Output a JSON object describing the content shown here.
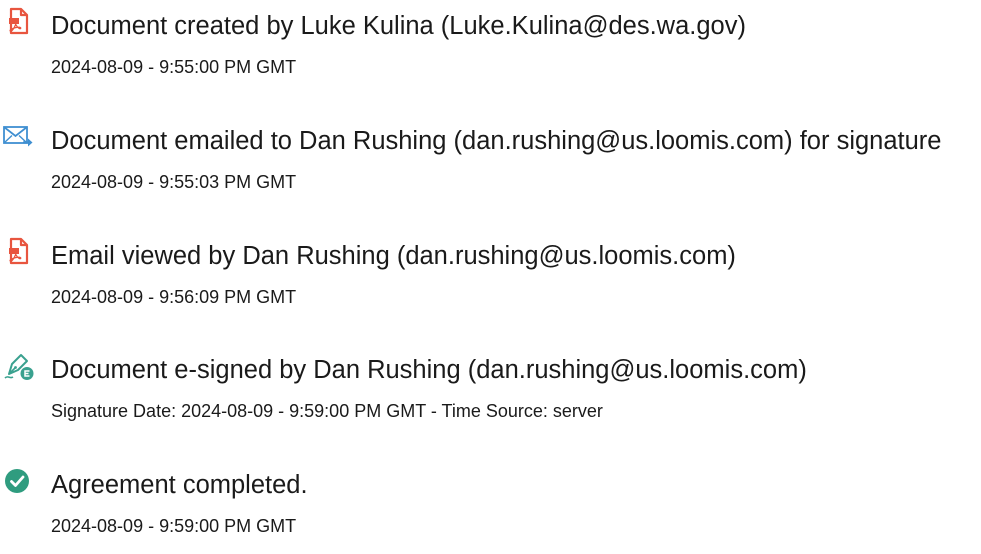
{
  "events": [
    {
      "icon": "document-created-icon",
      "title": "Document created by Luke Kulina (Luke.Kulina@des.wa.gov)",
      "detail": "2024-08-09 - 9:55:00 PM GMT"
    },
    {
      "icon": "email-sent-icon",
      "title": "Document emailed to Dan Rushing (dan.rushing@us.loomis.com) for signature",
      "detail": "2024-08-09 - 9:55:03 PM GMT"
    },
    {
      "icon": "email-viewed-icon",
      "title": "Email viewed by Dan Rushing (dan.rushing@us.loomis.com)",
      "detail": "2024-08-09 - 9:56:09 PM GMT"
    },
    {
      "icon": "e-signed-icon",
      "title": "Document e-signed by Dan Rushing (dan.rushing@us.loomis.com)",
      "detail": "Signature Date: 2024-08-09 - 9:59:00 PM GMT - Time Source: server"
    },
    {
      "icon": "agreement-completed-icon",
      "title": "Agreement completed.",
      "detail": "2024-08-09 - 9:59:00 PM GMT"
    }
  ],
  "colors": {
    "document_icon": "#e8553f",
    "email_icon": "#3f8fd1",
    "signed_icon": "#3aa18f",
    "completed_icon": "#2f9c7f",
    "text": "#1a1a1a"
  }
}
